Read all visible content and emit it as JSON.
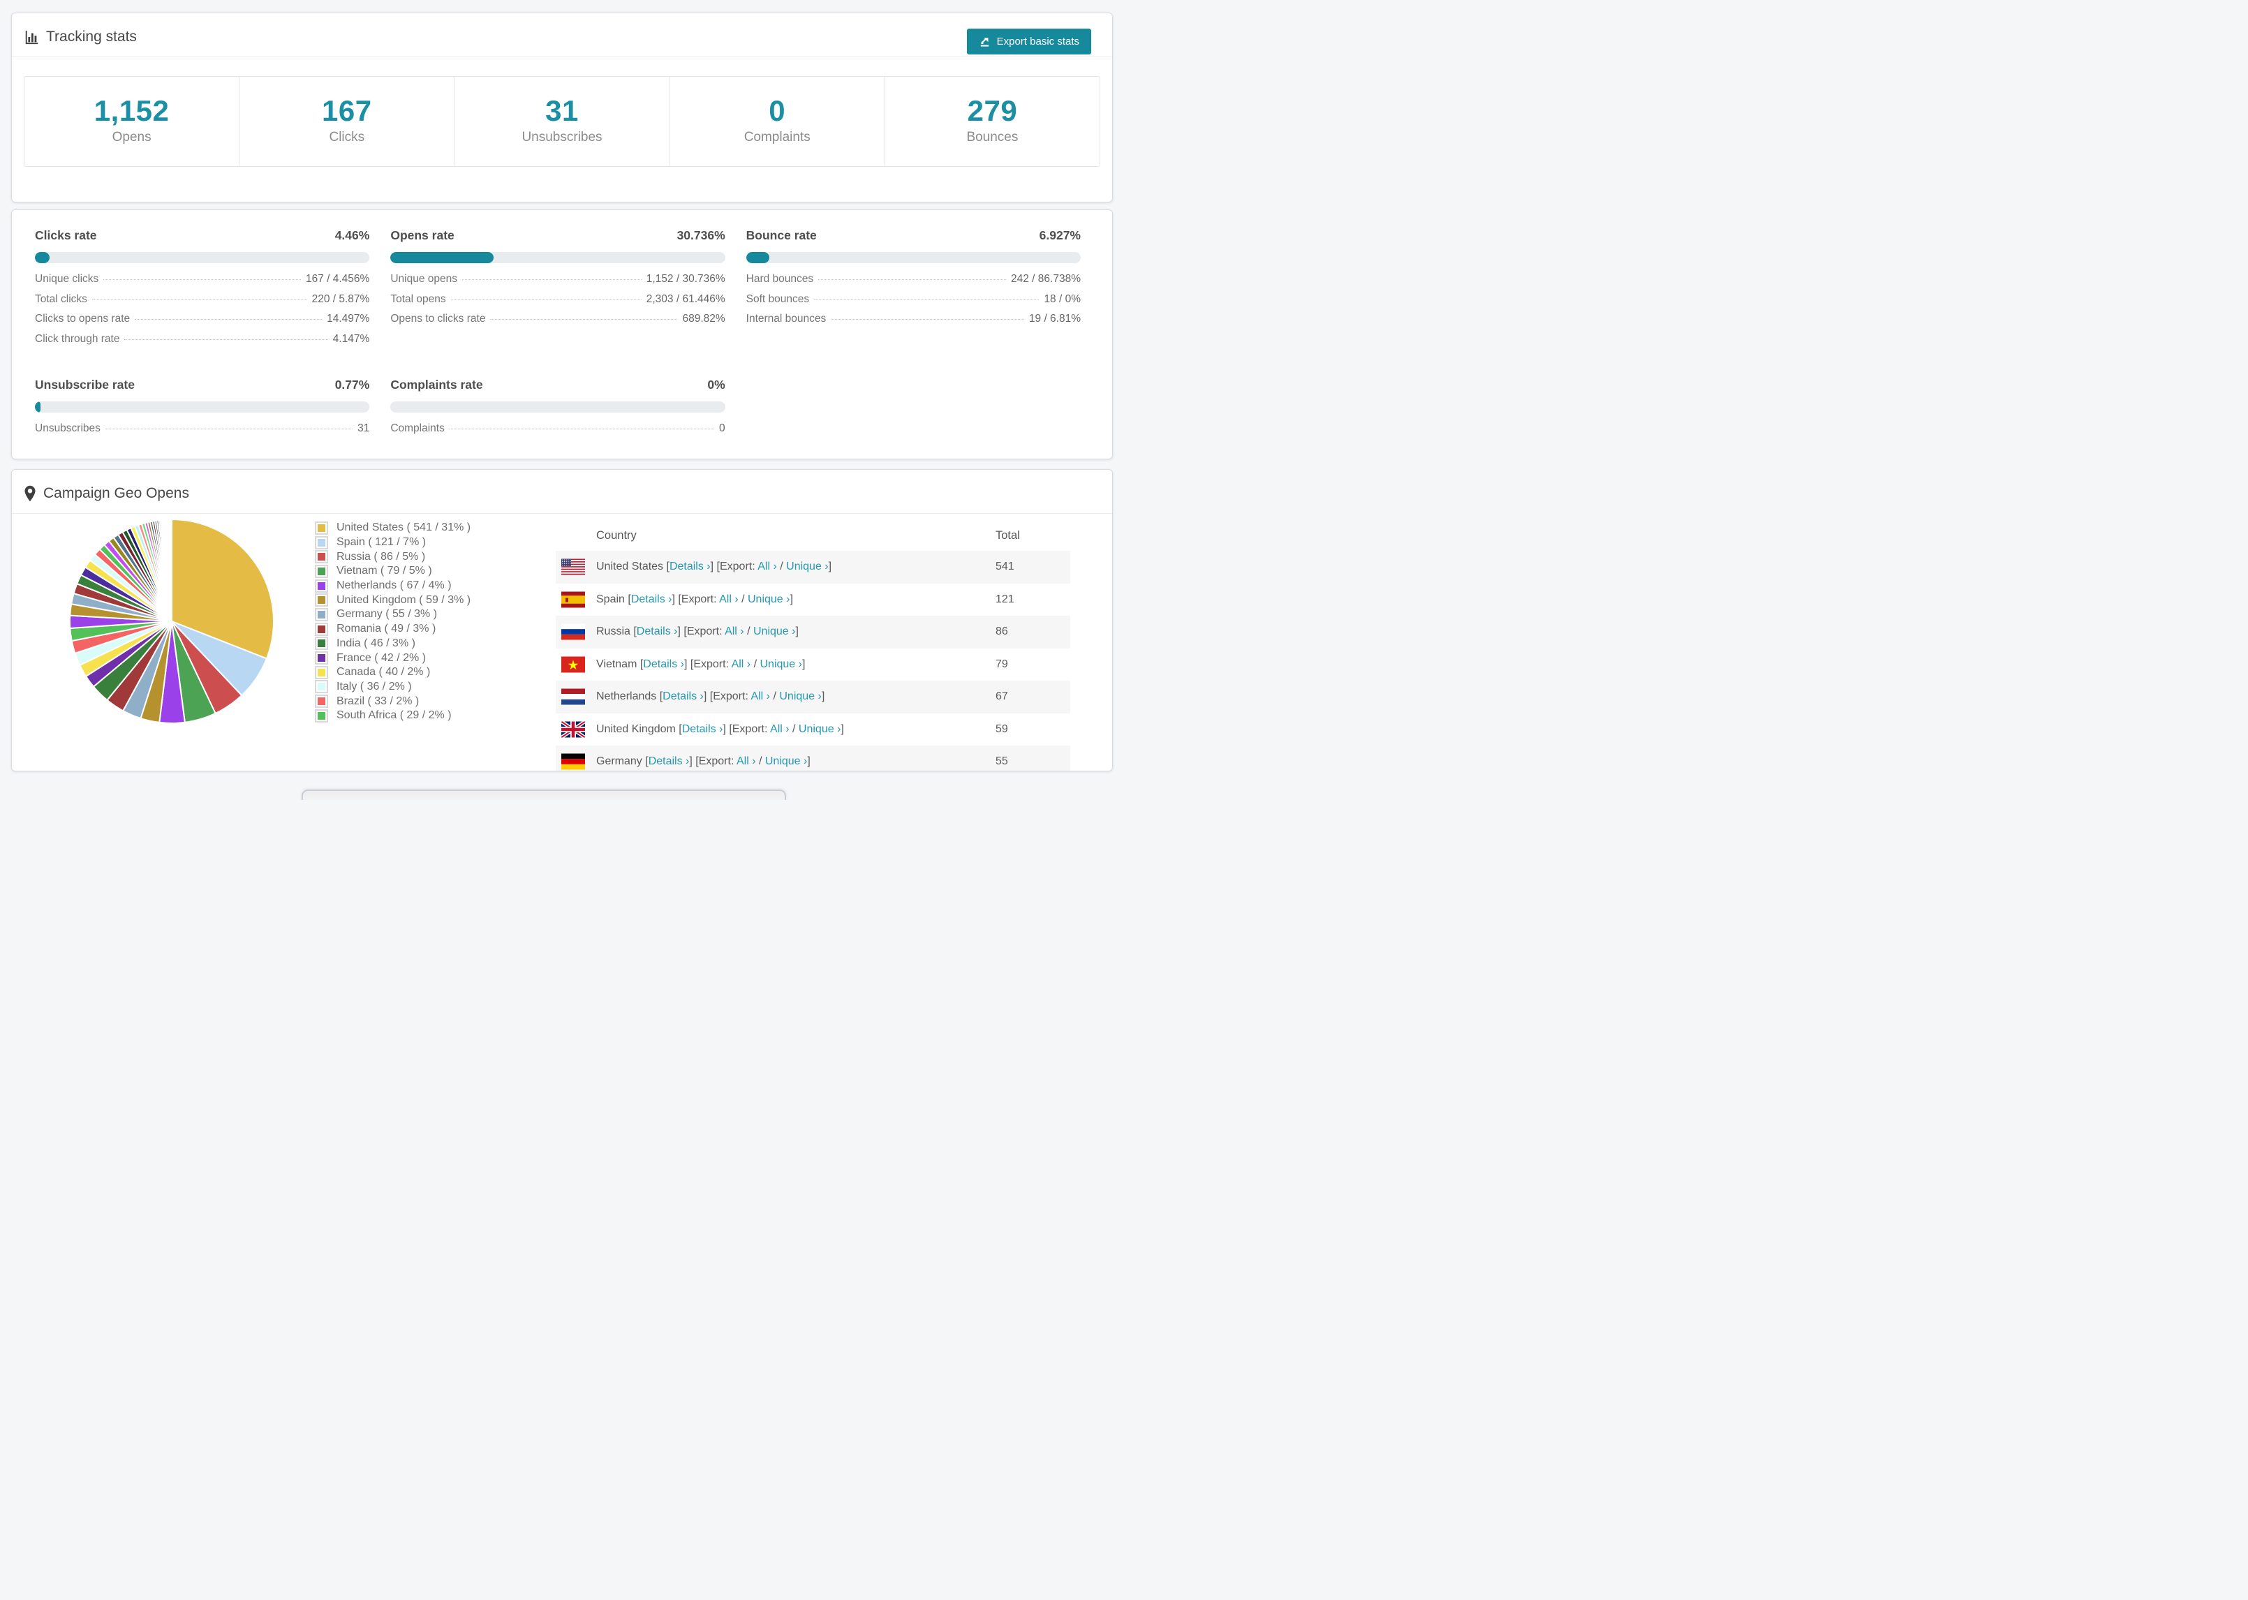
{
  "tracking": {
    "title": "Tracking stats",
    "export_button": "Export basic stats",
    "accent_color": "#17899d",
    "stats": [
      {
        "value": "1,152",
        "label": "Opens"
      },
      {
        "value": "167",
        "label": "Clicks"
      },
      {
        "value": "31",
        "label": "Unsubscribes"
      },
      {
        "value": "0",
        "label": "Complaints"
      },
      {
        "value": "279",
        "label": "Bounces"
      }
    ]
  },
  "rates": {
    "blocks": [
      {
        "title": "Clicks rate",
        "value": "4.46%",
        "fill_pct": 4.46,
        "rows": [
          [
            "Unique clicks",
            "167 / 4.456%"
          ],
          [
            "Total clicks",
            "220 / 5.87%"
          ],
          [
            "Clicks to opens rate",
            "14.497%"
          ],
          [
            "Click through rate",
            "4.147%"
          ]
        ]
      },
      {
        "title": "Opens rate",
        "value": "30.736%",
        "fill_pct": 30.736,
        "rows": [
          [
            "Unique opens",
            "1,152 / 30.736%"
          ],
          [
            "Total opens",
            "2,303 / 61.446%"
          ],
          [
            "Opens to clicks rate",
            "689.82%"
          ]
        ]
      },
      {
        "title": "Bounce rate",
        "value": "6.927%",
        "fill_pct": 6.927,
        "rows": [
          [
            "Hard bounces",
            "242 / 86.738%"
          ],
          [
            "Soft bounces",
            "18 / 0%"
          ],
          [
            "Internal bounces",
            "19 / 6.81%"
          ]
        ]
      },
      {
        "title": "Unsubscribe rate",
        "value": "0.77%",
        "fill_pct": 0.77,
        "rows": [
          [
            "Unsubscribes",
            "31"
          ]
        ]
      },
      {
        "title": "Complaints rate",
        "value": "0%",
        "fill_pct": 0,
        "rows": [
          [
            "Complaints",
            "0"
          ]
        ]
      }
    ]
  },
  "geo": {
    "title": "Campaign Geo Opens",
    "legend": [
      {
        "label": "United States ( 541 / 31% )",
        "color": "#e3bb45"
      },
      {
        "label": "Spain ( 121 / 7% )",
        "color": "#b7d7f3"
      },
      {
        "label": "Russia ( 86 / 5% )",
        "color": "#cc4e4e"
      },
      {
        "label": "Vietnam ( 79 / 5% )",
        "color": "#4ba353"
      },
      {
        "label": "Netherlands ( 67 / 4% )",
        "color": "#9b41e9"
      },
      {
        "label": "United Kingdom ( 59 / 3% )",
        "color": "#b5922d"
      },
      {
        "label": "Germany ( 55 / 3% )",
        "color": "#8fafc9"
      },
      {
        "label": "Romania ( 49 / 3% )",
        "color": "#a03a3a"
      },
      {
        "label": "India ( 46 / 3% )",
        "color": "#38803c"
      },
      {
        "label": "France ( 42 / 2% )",
        "color": "#7030aa"
      },
      {
        "label": "Canada ( 40 / 2% )",
        "color": "#f6e14e"
      },
      {
        "label": "Italy ( 36 / 2% )",
        "color": "#d9fbf9"
      },
      {
        "label": "Brazil ( 33 / 2% )",
        "color": "#f56464"
      },
      {
        "label": "South Africa ( 29 / 2% )",
        "color": "#52c159"
      }
    ],
    "table": {
      "country_header": "Country",
      "total_header": "Total",
      "labels": {
        "details": "Details ›",
        "all": "All ›",
        "unique": "Unique ›"
      },
      "syntax": {
        "open": " [",
        "export": "] [Export: ",
        "slash": " / ",
        "close": "]"
      },
      "rows": [
        {
          "country": "United States",
          "flag": "us",
          "total": "541"
        },
        {
          "country": "Spain",
          "flag": "es",
          "total": "121"
        },
        {
          "country": "Russia",
          "flag": "ru",
          "total": "86"
        },
        {
          "country": "Vietnam",
          "flag": "vn",
          "total": "79"
        },
        {
          "country": "Netherlands",
          "flag": "nl",
          "total": "67"
        },
        {
          "country": "United Kingdom",
          "flag": "gb",
          "total": "59"
        },
        {
          "country": "Germany",
          "flag": "de",
          "total": "55"
        }
      ]
    }
  },
  "chart_data": {
    "type": "pie",
    "title": "Campaign Geo Opens",
    "legend_position": "right",
    "start_angle_deg": -90,
    "direction": "clockwise",
    "slices": [
      {
        "label": "United States",
        "value": 541,
        "pct": 31,
        "color": "#e3bb45"
      },
      {
        "label": "Spain",
        "value": 121,
        "pct": 7,
        "color": "#b7d7f3"
      },
      {
        "label": "Russia",
        "value": 86,
        "pct": 5,
        "color": "#cc4e4e"
      },
      {
        "label": "Vietnam",
        "value": 79,
        "pct": 5,
        "color": "#4ba353"
      },
      {
        "label": "Netherlands",
        "value": 67,
        "pct": 4,
        "color": "#9b41e9"
      },
      {
        "label": "United Kingdom",
        "value": 59,
        "pct": 3,
        "color": "#b5922d"
      },
      {
        "label": "Germany",
        "value": 55,
        "pct": 3,
        "color": "#8fafc9"
      },
      {
        "label": "Romania",
        "value": 49,
        "pct": 3,
        "color": "#a03a3a"
      },
      {
        "label": "India",
        "value": 46,
        "pct": 3,
        "color": "#38803c"
      },
      {
        "label": "France",
        "value": 42,
        "pct": 2,
        "color": "#7030aa"
      },
      {
        "label": "Canada",
        "value": 40,
        "pct": 2,
        "color": "#f6e14e"
      },
      {
        "label": "Italy",
        "value": 36,
        "pct": 2,
        "color": "#d9fbf9"
      },
      {
        "label": "Brazil",
        "value": 33,
        "pct": 2,
        "color": "#f56464"
      },
      {
        "label": "South Africa",
        "value": 29,
        "pct": 2,
        "color": "#52c159"
      }
    ],
    "unlabeled_tail": {
      "note": "many small unlabeled country slices fanning toward 12 o'clock",
      "pct_each": [
        2.0,
        1.8,
        1.7,
        1.6,
        1.5,
        1.4,
        1.3,
        1.2,
        1.1,
        1.0,
        0.95,
        0.9,
        0.85,
        0.8,
        0.75,
        0.7,
        0.65,
        0.6,
        0.55,
        0.5,
        0.45,
        0.4,
        0.38,
        0.35,
        0.32,
        0.3,
        0.28,
        0.25,
        0.22,
        0.2,
        0.18,
        0.16,
        0.14,
        0.12,
        0.1,
        0.09,
        0.08,
        0.07,
        0.06,
        0.05,
        0.04,
        0.03
      ],
      "colors": [
        "#9b41e9",
        "#b5922d",
        "#8fafc9",
        "#a03a3a",
        "#38803c",
        "#4b2d9e",
        "#f6e14e",
        "#ddfbf9",
        "#f56464",
        "#52c159",
        "#c44df0",
        "#97891f",
        "#51748f",
        "#7a2431",
        "#1d5c2a",
        "#2b1d6e",
        "#f2ef4d",
        "#baf0ee",
        "#fa8a8a",
        "#66e07a",
        "#e05af0",
        "#8a7a1e",
        "#3c5a73",
        "#63202b",
        "#174a1f",
        "#3c2b86",
        "#d9d94b",
        "#c9f4f0",
        "#f9a0a0",
        "#81f59a",
        "#ef83f5",
        "#ada133",
        "#2f4f66",
        "#521a1a",
        "#0e3d16",
        "#241a5e",
        "#b9b93c",
        "#a8e8e4",
        "#f7bcbc",
        "#9df7b0",
        "#f5b0f8",
        "#c5bb4a"
      ]
    }
  }
}
